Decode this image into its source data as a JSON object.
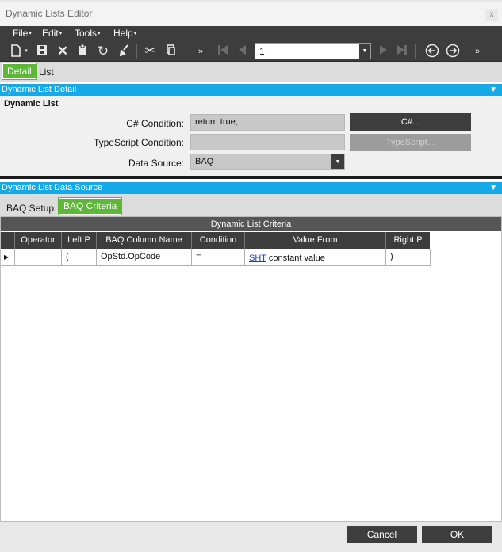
{
  "window": {
    "title": "Dynamic Lists Editor",
    "close_glyph": "x"
  },
  "menubar": {
    "items": [
      {
        "label": "File",
        "caret": "▾"
      },
      {
        "label": "Edit",
        "caret": "▾"
      },
      {
        "label": "Tools",
        "caret": "▾"
      },
      {
        "label": "Help",
        "caret": "▾"
      }
    ]
  },
  "toolbar": {
    "icons": [
      "new-icon",
      "save-icon",
      "delete-icon",
      "paste-icon",
      "refresh-icon",
      "clear-icon",
      "cut-icon",
      "copy-icon",
      "overflow-icon",
      "first-record-icon",
      "previous-record-icon",
      "next-record-icon",
      "last-record-icon",
      "back-icon",
      "forward-icon",
      "more-icon"
    ],
    "record_value": "1"
  },
  "top_tabs": [
    {
      "label": "Detail",
      "active": true
    },
    {
      "label": "List",
      "active": false
    }
  ],
  "detail_section": {
    "header": "Dynamic List Detail",
    "group_title": "Dynamic List",
    "csharp": {
      "label": "C# Condition:",
      "value": "return true;",
      "button": "C#..."
    },
    "typescript": {
      "label": "TypeScript Condition:",
      "value": "",
      "button": "TypeScript..."
    },
    "datasource": {
      "label": "Data Source:",
      "value": "BAQ"
    }
  },
  "datasource_section": {
    "header": "Dynamic List Data Source",
    "tabs": [
      {
        "label": "BAQ Setup",
        "active": false
      },
      {
        "label": "BAQ Criteria",
        "active": true
      }
    ]
  },
  "grid": {
    "caption": "Dynamic List Criteria",
    "columns": [
      "Operator",
      "Left P",
      "BAQ Column Name",
      "Condition",
      "Value From",
      "Right P"
    ],
    "rows": [
      {
        "operator": "",
        "left_p": "(",
        "column": "OpStd.OpCode",
        "condition": "=",
        "value_link": "SHT",
        "value_from": "constant value",
        "right_p": ")"
      }
    ]
  },
  "footer": {
    "cancel": "Cancel",
    "ok": "OK"
  },
  "colors": {
    "accent_blue": "#16a9e8",
    "active_tab_green": "#5db838",
    "toolbar_dark": "#3d3d3d"
  }
}
